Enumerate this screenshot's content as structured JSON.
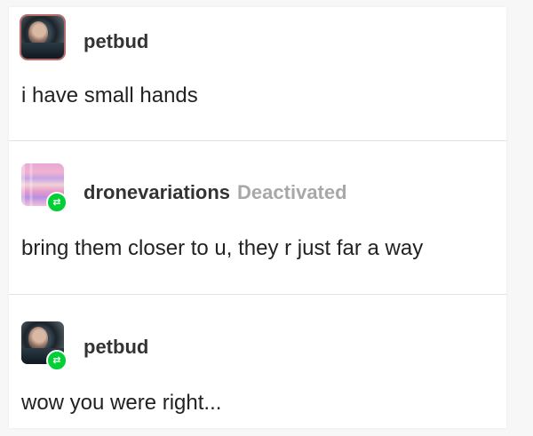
{
  "posts": [
    {
      "username": "petbud",
      "status": "",
      "text": "i have small hands",
      "avatar": "photo-avatar",
      "reblog_icon": ""
    },
    {
      "username": "dronevariations",
      "status": "Deactivated",
      "text": "bring them closer to u, they r just far a way",
      "avatar": "glitch-art-avatar",
      "reblog_icon": "reblog-icon"
    },
    {
      "username": "petbud",
      "status": "",
      "text": "wow you were right...",
      "avatar": "photo-avatar",
      "reblog_icon": "reblog-icon"
    }
  ],
  "colors": {
    "reblog_badge": "#00cf35",
    "status_text": "#a8a8a8",
    "username": "#333333"
  }
}
